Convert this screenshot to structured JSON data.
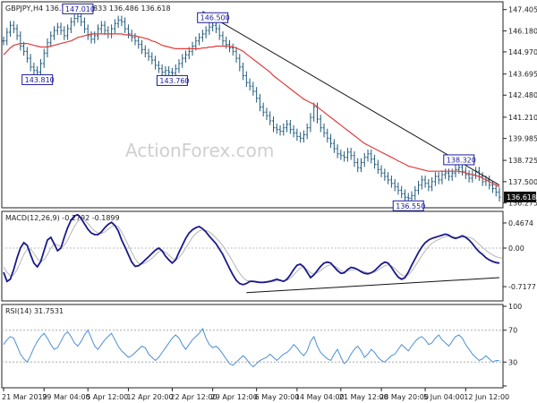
{
  "header": {
    "symbol_line": "GBPJPY,H4  136.779 136.833 136.486 136.618"
  },
  "watermark": "ActionForex.com",
  "colors": {
    "price": "#1f5a7a",
    "ma": "#e23b3b",
    "macd": "#1a1a8c",
    "signal": "#b5b5b5",
    "rsi": "#4c8fd6",
    "trendline": "#111111",
    "current_tag_bg": "#111111",
    "label_box": "#1b1b9e"
  },
  "chart_data": [
    {
      "type": "candlestick",
      "title": "GBPJPY,H4  136.779 136.833 136.486 136.618",
      "y_ticks": [
        {
          "label": "147.405",
          "value": 147.405
        },
        {
          "label": "146.180",
          "value": 146.18
        },
        {
          "label": "144.970",
          "value": 144.97
        },
        {
          "label": "143.695",
          "value": 143.695
        },
        {
          "label": "142.480",
          "value": 142.48
        },
        {
          "label": "141.210",
          "value": 141.21
        },
        {
          "label": "139.985",
          "value": 139.985
        },
        {
          "label": "138.725",
          "value": 138.725
        },
        {
          "label": "137.500",
          "value": 137.5
        },
        {
          "label": "136.275",
          "value": 136.275
        }
      ],
      "ylim": [
        136.1,
        147.75
      ],
      "current_price": {
        "label": "136.618",
        "value": 136.618
      },
      "annotations": [
        {
          "label": "147.010",
          "index": 22,
          "value": 147.01
        },
        {
          "label": "143.810",
          "index": 10,
          "value": 143.81
        },
        {
          "label": "146.500",
          "index": 62,
          "value": 146.5
        },
        {
          "label": "143.760",
          "index": 50,
          "value": 143.76
        },
        {
          "label": "138.320",
          "index": 135,
          "value": 138.32
        },
        {
          "label": "136.550",
          "index": 120,
          "value": 136.55
        }
      ],
      "series": [
        {
          "name": "Close",
          "values": [
            145.6,
            146.1,
            146.5,
            146.3,
            145.9,
            145.3,
            145.0,
            144.6,
            144.1,
            143.9,
            143.81,
            144.3,
            144.9,
            145.5,
            145.9,
            146.2,
            146.4,
            146.2,
            145.9,
            146.3,
            146.7,
            146.9,
            147.01,
            146.7,
            146.3,
            145.9,
            145.7,
            145.9,
            146.3,
            146.5,
            146.2,
            146.0,
            146.3,
            146.6,
            146.8,
            146.7,
            146.3,
            146.0,
            145.8,
            145.6,
            145.4,
            145.1,
            144.9,
            144.7,
            144.5,
            144.2,
            144.0,
            143.8,
            143.9,
            143.8,
            143.76,
            144.0,
            144.3,
            144.6,
            144.8,
            145.0,
            145.3,
            145.6,
            145.8,
            146.0,
            146.2,
            146.4,
            146.5,
            146.3,
            145.9,
            145.6,
            145.4,
            145.2,
            145.0,
            144.6,
            144.1,
            143.6,
            143.2,
            143.0,
            142.7,
            142.3,
            141.8,
            141.5,
            141.3,
            141.0,
            140.6,
            140.5,
            140.4,
            140.6,
            140.8,
            140.5,
            140.3,
            140.1,
            140.0,
            140.2,
            140.6,
            141.2,
            141.8,
            141.1,
            140.6,
            140.3,
            140.0,
            139.7,
            139.4,
            139.1,
            139.0,
            138.9,
            139.2,
            139.0,
            138.6,
            138.3,
            138.6,
            138.9,
            139.1,
            138.8,
            138.5,
            138.2,
            138.0,
            137.8,
            137.6,
            137.4,
            137.2,
            137.0,
            136.8,
            136.6,
            136.55,
            136.7,
            137.0,
            137.3,
            137.6,
            137.4,
            137.2,
            137.5,
            137.8,
            137.6,
            137.9,
            138.0,
            137.8,
            138.0,
            138.2,
            138.32,
            138.1,
            137.9,
            137.7,
            137.9,
            138.1,
            137.8,
            137.5,
            137.6,
            137.3,
            137.1,
            136.9,
            136.6
          ]
        },
        {
          "name": "MA",
          "values": [
            144.8,
            145.0,
            145.2,
            145.35,
            145.4,
            145.45,
            145.45,
            145.45,
            145.4,
            145.35,
            145.3,
            145.25,
            145.25,
            145.25,
            145.3,
            145.35,
            145.4,
            145.45,
            145.5,
            145.55,
            145.6,
            145.7,
            145.8,
            145.85,
            145.9,
            145.95,
            146.0,
            146.0,
            146.0,
            146.0,
            146.0,
            146.0,
            146.0,
            146.0,
            146.0,
            146.0,
            145.95,
            145.95,
            145.9,
            145.9,
            145.85,
            145.8,
            145.75,
            145.7,
            145.6,
            145.55,
            145.45,
            145.35,
            145.3,
            145.25,
            145.2,
            145.15,
            145.15,
            145.15,
            145.15,
            145.15,
            145.15,
            145.15,
            145.15,
            145.2,
            145.2,
            145.25,
            145.25,
            145.3,
            145.3,
            145.3,
            145.3,
            145.3,
            145.25,
            145.2,
            145.1,
            145.0,
            144.85,
            144.7,
            144.55,
            144.4,
            144.25,
            144.1,
            143.95,
            143.8,
            143.6,
            143.45,
            143.3,
            143.15,
            143.0,
            142.85,
            142.7,
            142.55,
            142.4,
            142.25,
            142.15,
            142.05,
            141.95,
            141.8,
            141.65,
            141.5,
            141.35,
            141.2,
            141.05,
            140.9,
            140.75,
            140.6,
            140.45,
            140.3,
            140.15,
            140.0,
            139.85,
            139.7,
            139.6,
            139.5,
            139.4,
            139.3,
            139.2,
            139.1,
            139.0,
            138.9,
            138.8,
            138.7,
            138.6,
            138.5,
            138.4,
            138.35,
            138.3,
            138.25,
            138.2,
            138.15,
            138.1,
            138.1,
            138.1,
            138.1,
            138.1,
            138.1,
            138.1,
            138.1,
            138.1,
            138.1,
            138.05,
            138.0,
            137.95,
            137.9,
            137.85,
            137.8,
            137.7,
            137.6,
            137.5,
            137.4,
            137.3,
            137.2
          ]
        }
      ],
      "trendline": {
        "from": {
          "index": 59,
          "value": 147.3
        },
        "to": {
          "index": 147,
          "value": 137.3
        }
      }
    },
    {
      "type": "line",
      "title": "MACD(12,26,9) -0.2792 -0.1899",
      "y_ticks": [
        {
          "label": "0.4674",
          "value": 0.4674
        },
        {
          "label": "0.00",
          "value": 0.0
        },
        {
          "label": "-0.7177",
          "value": -0.7177
        }
      ],
      "ylim": [
        -0.95,
        0.65
      ],
      "series": [
        {
          "name": "MACD",
          "values": [
            -0.45,
            -0.62,
            -0.58,
            -0.4,
            -0.18,
            0.0,
            0.1,
            0.05,
            -0.12,
            -0.28,
            -0.35,
            -0.25,
            -0.05,
            0.15,
            0.2,
            0.08,
            -0.05,
            0.0,
            0.2,
            0.38,
            0.52,
            0.6,
            0.62,
            0.55,
            0.45,
            0.35,
            0.28,
            0.25,
            0.25,
            0.3,
            0.38,
            0.44,
            0.48,
            0.42,
            0.32,
            0.15,
            0.02,
            -0.12,
            -0.26,
            -0.34,
            -0.33,
            -0.28,
            -0.22,
            -0.16,
            -0.1,
            -0.04,
            0.0,
            -0.05,
            -0.15,
            -0.22,
            -0.28,
            -0.22,
            -0.08,
            0.05,
            0.18,
            0.28,
            0.34,
            0.38,
            0.4,
            0.36,
            0.3,
            0.22,
            0.15,
            0.08,
            -0.02,
            -0.12,
            -0.25,
            -0.38,
            -0.5,
            -0.6,
            -0.66,
            -0.68,
            -0.66,
            -0.62,
            -0.62,
            -0.63,
            -0.64,
            -0.64,
            -0.63,
            -0.62,
            -0.6,
            -0.58,
            -0.6,
            -0.62,
            -0.58,
            -0.5,
            -0.4,
            -0.32,
            -0.3,
            -0.35,
            -0.45,
            -0.55,
            -0.5,
            -0.42,
            -0.34,
            -0.28,
            -0.26,
            -0.28,
            -0.35,
            -0.42,
            -0.47,
            -0.46,
            -0.4,
            -0.36,
            -0.37,
            -0.4,
            -0.44,
            -0.47,
            -0.48,
            -0.46,
            -0.42,
            -0.36,
            -0.3,
            -0.26,
            -0.28,
            -0.36,
            -0.46,
            -0.54,
            -0.58,
            -0.55,
            -0.45,
            -0.32,
            -0.2,
            -0.08,
            0.02,
            0.1,
            0.15,
            0.18,
            0.2,
            0.22,
            0.24,
            0.26,
            0.24,
            0.2,
            0.18,
            0.2,
            0.23,
            0.2,
            0.15,
            0.08,
            0.0,
            -0.07,
            -0.12,
            -0.18,
            -0.22,
            -0.25,
            -0.27,
            -0.28
          ]
        },
        {
          "name": "Signal",
          "values": [
            -0.35,
            -0.45,
            -0.52,
            -0.5,
            -0.4,
            -0.26,
            -0.12,
            -0.02,
            -0.02,
            -0.1,
            -0.2,
            -0.25,
            -0.22,
            -0.12,
            0.0,
            0.08,
            0.06,
            0.02,
            0.05,
            0.15,
            0.28,
            0.4,
            0.5,
            0.54,
            0.52,
            0.46,
            0.38,
            0.32,
            0.28,
            0.27,
            0.3,
            0.35,
            0.4,
            0.42,
            0.4,
            0.3,
            0.18,
            0.05,
            -0.08,
            -0.2,
            -0.28,
            -0.3,
            -0.28,
            -0.24,
            -0.19,
            -0.13,
            -0.07,
            -0.05,
            -0.08,
            -0.13,
            -0.19,
            -0.22,
            -0.18,
            -0.1,
            0.0,
            0.1,
            0.2,
            0.27,
            0.32,
            0.34,
            0.33,
            0.3,
            0.25,
            0.19,
            0.12,
            0.04,
            -0.05,
            -0.15,
            -0.26,
            -0.37,
            -0.47,
            -0.55,
            -0.6,
            -0.62,
            -0.62,
            -0.62,
            -0.63,
            -0.63,
            -0.63,
            -0.63,
            -0.62,
            -0.61,
            -0.6,
            -0.61,
            -0.6,
            -0.56,
            -0.5,
            -0.43,
            -0.37,
            -0.36,
            -0.4,
            -0.46,
            -0.48,
            -0.46,
            -0.42,
            -0.37,
            -0.33,
            -0.31,
            -0.33,
            -0.37,
            -0.42,
            -0.44,
            -0.43,
            -0.41,
            -0.4,
            -0.4,
            -0.42,
            -0.44,
            -0.46,
            -0.46,
            -0.45,
            -0.41,
            -0.37,
            -0.33,
            -0.31,
            -0.33,
            -0.38,
            -0.44,
            -0.5,
            -0.52,
            -0.5,
            -0.43,
            -0.34,
            -0.24,
            -0.14,
            -0.05,
            0.03,
            0.09,
            0.13,
            0.16,
            0.19,
            0.21,
            0.22,
            0.21,
            0.2,
            0.2,
            0.2,
            0.21,
            0.2,
            0.18,
            0.13,
            0.07,
            0.01,
            -0.04,
            -0.09,
            -0.13,
            -0.16,
            -0.18,
            -0.19
          ]
        }
      ],
      "trendline": {
        "from": {
          "index": 72,
          "value": -0.83
        },
        "to": {
          "index": 147,
          "value": -0.55
        }
      }
    },
    {
      "type": "line",
      "title": "RSI(14) 31.7531",
      "y_ticks": [
        {
          "label": "100",
          "value": 100
        },
        {
          "label": "70",
          "value": 70
        },
        {
          "label": "30",
          "value": 30
        },
        {
          "label": "0",
          "value": 0
        }
      ],
      "ylim": [
        0,
        100
      ],
      "levels": [
        70,
        30
      ],
      "series": [
        {
          "name": "RSI",
          "values": [
            52,
            58,
            62,
            60,
            50,
            40,
            34,
            30,
            38,
            48,
            56,
            62,
            66,
            60,
            52,
            46,
            48,
            56,
            64,
            68,
            62,
            54,
            50,
            56,
            64,
            70,
            60,
            50,
            46,
            52,
            58,
            62,
            66,
            58,
            50,
            44,
            40,
            36,
            38,
            42,
            46,
            50,
            48,
            40,
            36,
            32,
            36,
            42,
            48,
            54,
            60,
            64,
            60,
            52,
            46,
            52,
            58,
            62,
            66,
            72,
            60,
            52,
            48,
            50,
            46,
            40,
            34,
            28,
            26,
            30,
            34,
            38,
            34,
            28,
            24,
            28,
            32,
            34,
            36,
            40,
            36,
            32,
            36,
            40,
            42,
            46,
            52,
            48,
            42,
            38,
            44,
            56,
            62,
            50,
            42,
            38,
            34,
            32,
            40,
            46,
            36,
            28,
            32,
            40,
            46,
            50,
            44,
            36,
            40,
            46,
            42,
            36,
            32,
            30,
            34,
            38,
            40,
            46,
            52,
            48,
            44,
            50,
            56,
            60,
            62,
            58,
            52,
            54,
            60,
            64,
            58,
            54,
            50,
            56,
            62,
            64,
            60,
            52,
            46,
            40,
            36,
            32,
            34,
            38,
            34,
            30,
            32,
            31.75
          ]
        }
      ]
    }
  ],
  "x_axis": {
    "labels": [
      "21 Mar 2019",
      "29 Mar 04:00",
      "5 Apr 12:00",
      "12 Apr 20:00",
      "22 Apr 12:00",
      "29 Apr 12:00",
      "6 May 20:00",
      "14 May 04:00",
      "21 May 12:00",
      "28 May 20:00",
      "5 Jun 04:00",
      "12 Jun 12:00"
    ],
    "label_indices": [
      0,
      12,
      25,
      37,
      50,
      62,
      75,
      87,
      100,
      112,
      125,
      137
    ]
  }
}
